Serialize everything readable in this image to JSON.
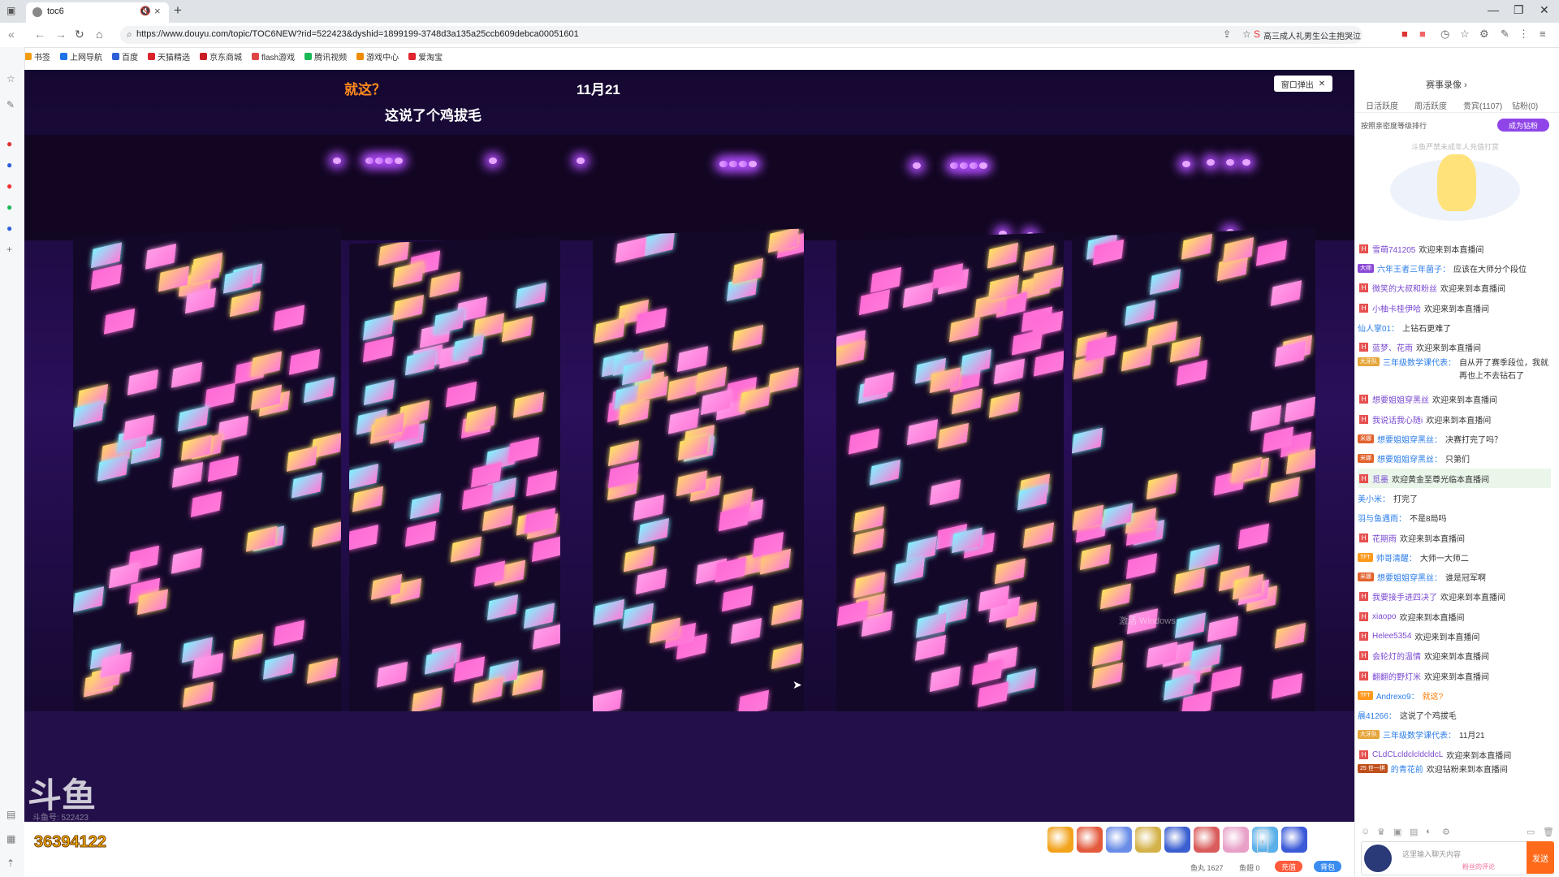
{
  "browser": {
    "tab_title": "toc6",
    "url": "https://www.douyu.com/topic/TOC6NEW?rid=522423&dyshid=1899199-3748d3a135a25ccb609debca00051601",
    "search_suggestion": "高三成人礼男生公主抱哭泣",
    "new_tab": "+",
    "minimize": "—",
    "restore": "❐",
    "close": "✕"
  },
  "bookmarks": [
    {
      "label": "书签",
      "color": "#f39c12"
    },
    {
      "label": "上网导航",
      "color": "#1e73e8"
    },
    {
      "label": "百度",
      "color": "#2f5fd8"
    },
    {
      "label": "天猫精选",
      "color": "#d8232a"
    },
    {
      "label": "京东商城",
      "color": "#c71d23"
    },
    {
      "label": "flash游戏",
      "color": "#e04545"
    },
    {
      "label": "腾讯视频",
      "color": "#19b955"
    },
    {
      "label": "游戏中心",
      "color": "#f08a00"
    },
    {
      "label": "爱淘宝",
      "color": "#e0252e"
    }
  ],
  "video": {
    "caption_orange": "就这？",
    "caption_white": "这说了个鸡拔毛",
    "caption_date": "11月21",
    "popout_label": "窗口弹出",
    "logo": "斗鱼",
    "room_id": "斗鱼号: 522423",
    "watermark": "激活 Windows"
  },
  "bottom": {
    "count": "36394122",
    "count_sub": "活动图标",
    "gift_colors": [
      "#f2a31c",
      "#e35a3c",
      "#6a8de8",
      "#d4b24a",
      "#3b5fd0",
      "#d95b5b",
      "#e8a0c8",
      "#5ab0e8",
      "#3a5ad8"
    ],
    "yuwan_label": "鱼丸 1627",
    "yuchi_label": "鱼翅 0",
    "recharge_label": "充值",
    "backpack_label": "背包"
  },
  "right_panel": {
    "rank_title": "赛事录像 ›",
    "tabs": [
      "日活跃度",
      "周活跃度",
      "贵宾(1107)",
      "钻粉(0)"
    ],
    "rank_desc": "按照亲密度等级排行",
    "join_label": "成为钻粉",
    "tip": "斗鱼严禁未成年人充值打赏"
  },
  "chat": [
    {
      "badge": "H",
      "user": "雪萌741205",
      "text": "欢迎来到本直播间"
    },
    {
      "badge": "大师",
      "user": "六年王者三年菌子：",
      "text": "应该在大师分个段位",
      "tall": false
    },
    {
      "badge": "H",
      "user": "微笑的大叔和粉丝",
      "text": "欢迎来到本直播间"
    },
    {
      "badge": "H",
      "user": "小柚卡桂伊哈",
      "text": "欢迎来到本直播间"
    },
    {
      "badge": "",
      "user": "仙人掌01：",
      "text": "上钻石更难了"
    },
    {
      "badge": "H",
      "user": "蓝梦、花雨",
      "text": "欢迎来到本直播间"
    },
    {
      "badge": "大牙队",
      "user": "三年级数学课代表：",
      "text": "自从开了赛季段位，我就再也上不去钻石了",
      "tall": true
    },
    {
      "badge": "H",
      "user": "想要姐姐穿黑丝",
      "text": "欢迎来到本直播间"
    },
    {
      "badge": "H",
      "user": "我说话我心随i",
      "text": "欢迎来到本直播间"
    },
    {
      "badge": "米娜",
      "user": "想要姐姐穿黑丝：",
      "text": "决赛打完了吗？"
    },
    {
      "badge": "米娜",
      "user": "想要姐姐穿黑丝：",
      "text": "只第们"
    },
    {
      "badge": "H",
      "user": "觅墨",
      "text": "欢迎黄金至尊光临本直播间",
      "highlight": true
    },
    {
      "badge": "",
      "user": "美小米：",
      "text": "打完了"
    },
    {
      "badge": "",
      "user": "羽与鱼遇雨：",
      "text": "不是8局吗"
    },
    {
      "badge": "H",
      "user": "花期雨",
      "text": "欢迎来到本直播间"
    },
    {
      "badge": "TFT",
      "user": "帅哥清醒：",
      "text": "大师一大师二"
    },
    {
      "badge": "米娜",
      "user": "想要姐姐穿黑丝：",
      "text": "谁是冠军啊"
    },
    {
      "badge": "H",
      "user": "我要接手进四决了",
      "text": "欢迎来到本直播间"
    },
    {
      "badge": "H",
      "user": "xiaopo",
      "text": "欢迎来到本直播间"
    },
    {
      "badge": "H",
      "user": "Helee5354",
      "text": "欢迎来到本直播间"
    },
    {
      "badge": "H",
      "user": "会轮灯的温情",
      "text": "欢迎来到本直播间"
    },
    {
      "badge": "H",
      "user": "翻翻的野灯米",
      "text": "欢迎来到本直播间"
    },
    {
      "badge": "TFT",
      "user": "Andrexo9：",
      "text": "就这?",
      "orange": true
    },
    {
      "badge": "",
      "user": "晨41266：",
      "text": "这说了个鸡拔毛"
    },
    {
      "badge": "大牙队",
      "user": "三年级数学课代表：",
      "text": "11月21"
    },
    {
      "badge": "H",
      "user": "CLdCLcldclcldcldcL",
      "text": "欢迎来到本直播间"
    },
    {
      "badge": "25 世一棋",
      "user": "的青花前",
      "text": "欢迎钻粉来到本直播间",
      "tall": true
    }
  ],
  "chat_input": {
    "placeholder": "这里输入聊天内容",
    "sub": "粉丝的评论",
    "send_label": "发送"
  }
}
